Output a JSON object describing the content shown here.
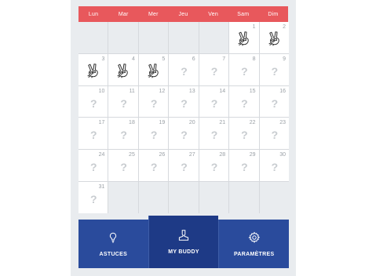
{
  "calendar": {
    "weekdays": [
      "Lun",
      "Mar",
      "Mer",
      "Jeu",
      "Ven",
      "Sam",
      "Dim"
    ],
    "days": [
      {
        "n": "1",
        "status": "peace"
      },
      {
        "n": "2",
        "status": "peace"
      },
      {
        "n": "3",
        "status": "peace"
      },
      {
        "n": "4",
        "status": "peace"
      },
      {
        "n": "5",
        "status": "peace"
      },
      {
        "n": "6",
        "status": "unknown"
      },
      {
        "n": "7",
        "status": "unknown"
      },
      {
        "n": "8",
        "status": "unknown"
      },
      {
        "n": "9",
        "status": "unknown"
      },
      {
        "n": "10",
        "status": "unknown"
      },
      {
        "n": "11",
        "status": "unknown"
      },
      {
        "n": "12",
        "status": "unknown"
      },
      {
        "n": "13",
        "status": "unknown"
      },
      {
        "n": "14",
        "status": "unknown"
      },
      {
        "n": "15",
        "status": "unknown"
      },
      {
        "n": "16",
        "status": "unknown"
      },
      {
        "n": "17",
        "status": "unknown"
      },
      {
        "n": "18",
        "status": "unknown"
      },
      {
        "n": "19",
        "status": "unknown"
      },
      {
        "n": "20",
        "status": "unknown"
      },
      {
        "n": "21",
        "status": "unknown"
      },
      {
        "n": "22",
        "status": "unknown"
      },
      {
        "n": "23",
        "status": "unknown"
      },
      {
        "n": "24",
        "status": "unknown"
      },
      {
        "n": "25",
        "status": "unknown"
      },
      {
        "n": "26",
        "status": "unknown"
      },
      {
        "n": "27",
        "status": "unknown"
      },
      {
        "n": "28",
        "status": "unknown"
      },
      {
        "n": "29",
        "status": "unknown"
      },
      {
        "n": "30",
        "status": "unknown"
      },
      {
        "n": "31",
        "status": "unknown"
      }
    ],
    "leading_empty": 5,
    "unknown_glyph": "?",
    "status_icons": {
      "peace": "peace-hand-icon",
      "unknown": "question-mark-icon"
    }
  },
  "tabbar": {
    "tabs": [
      {
        "label": "ASTUCES",
        "icon": "lightbulb-icon",
        "active": false
      },
      {
        "label": "MY BUDDY",
        "icon": "person-icon",
        "active": true
      },
      {
        "label": "PARAMÈTRES",
        "icon": "gear-icon",
        "active": false
      }
    ]
  },
  "colors": {
    "header": "#e8585c",
    "tabbar": "#2a4b9c",
    "tab_active": "#1e3a86"
  }
}
